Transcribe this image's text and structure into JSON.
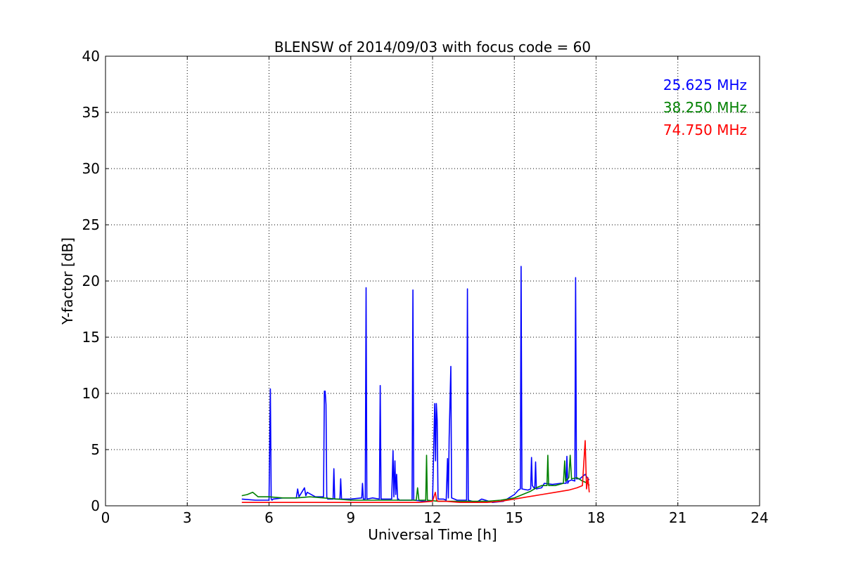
{
  "chart_data": {
    "type": "line",
    "title": "BLENSW of 2014/09/03 with focus code = 60",
    "xlabel": "Universal Time [h]",
    "ylabel": "Y-factor [dB]",
    "xlim": [
      0,
      24
    ],
    "ylim": [
      0,
      40
    ],
    "xticks": [
      0,
      3,
      6,
      9,
      12,
      15,
      18,
      21,
      24
    ],
    "xtick_labels": [
      "0",
      "3",
      "6",
      "9",
      "12",
      "15",
      "18",
      "21",
      "24"
    ],
    "yticks": [
      0,
      5,
      10,
      15,
      20,
      25,
      30,
      35,
      40
    ],
    "ytick_labels": [
      "0",
      "5",
      "10",
      "15",
      "20",
      "25",
      "30",
      "35",
      "40"
    ],
    "grid": true,
    "legend_position": "top-right",
    "series": [
      {
        "name": "25.625 MHz",
        "color": "#0000ff",
        "x": [
          5.0,
          5.5,
          6.0,
          6.05,
          6.08,
          6.11,
          6.15,
          6.5,
          7.0,
          7.05,
          7.1,
          7.3,
          7.35,
          7.4,
          7.7,
          8.0,
          8.03,
          8.06,
          8.09,
          8.12,
          8.15,
          8.35,
          8.38,
          8.41,
          8.6,
          8.63,
          8.66,
          9.0,
          9.4,
          9.43,
          9.46,
          9.53,
          9.56,
          9.59,
          9.8,
          10.05,
          10.08,
          10.11,
          10.5,
          10.55,
          10.58,
          10.62,
          10.65,
          10.68,
          10.72,
          10.75,
          10.78,
          10.9,
          11.25,
          11.28,
          11.31,
          11.7,
          12.0,
          12.08,
          12.11,
          12.14,
          12.17,
          12.2,
          12.25,
          12.4,
          12.5,
          12.55,
          12.58,
          12.61,
          12.64,
          12.67,
          12.7,
          12.9,
          13.25,
          13.28,
          13.31,
          13.6,
          13.8,
          14.2,
          14.6,
          15.0,
          15.15,
          15.22,
          15.25,
          15.28,
          15.5,
          15.6,
          15.63,
          15.66,
          15.75,
          15.78,
          15.81,
          16.0,
          16.1,
          16.4,
          16.7,
          16.9,
          16.93,
          16.96,
          17.0,
          17.1,
          17.22,
          17.25,
          17.28,
          17.4,
          17.5,
          17.6,
          17.7,
          17.75
        ],
        "y": [
          0.6,
          0.5,
          0.5,
          10.4,
          0.6,
          0.5,
          0.6,
          0.7,
          0.7,
          1.5,
          0.8,
          1.6,
          0.9,
          1.2,
          0.8,
          0.8,
          10.2,
          10.2,
          9.0,
          0.8,
          0.6,
          0.6,
          3.3,
          0.6,
          0.6,
          2.4,
          0.6,
          0.6,
          0.7,
          2.0,
          0.6,
          0.6,
          19.4,
          0.6,
          0.7,
          0.6,
          10.7,
          0.6,
          0.6,
          4.9,
          0.8,
          4.0,
          1.0,
          2.8,
          0.5,
          0.6,
          0.5,
          0.5,
          0.5,
          19.2,
          0.5,
          0.4,
          0.4,
          9.1,
          4.0,
          9.1,
          7.6,
          0.6,
          0.6,
          0.6,
          0.5,
          4.2,
          0.7,
          6.0,
          9.2,
          12.4,
          0.7,
          0.5,
          0.5,
          19.3,
          0.5,
          0.3,
          0.6,
          0.3,
          0.4,
          1.0,
          1.4,
          1.5,
          21.3,
          1.5,
          1.4,
          1.5,
          4.3,
          1.8,
          1.5,
          3.9,
          1.5,
          1.6,
          2.0,
          1.9,
          2.0,
          2.0,
          4.4,
          2.0,
          2.2,
          2.3,
          2.2,
          20.3,
          2.4,
          2.4,
          2.6,
          2.8,
          2.4,
          2.3
        ]
      },
      {
        "name": "38.250 MHz",
        "color": "#008000",
        "x": [
          5.0,
          5.2,
          5.4,
          5.6,
          6.0,
          6.5,
          7.0,
          7.5,
          8.0,
          8.5,
          9.0,
          9.5,
          10.0,
          10.5,
          11.0,
          11.4,
          11.45,
          11.5,
          11.75,
          11.78,
          11.81,
          12.2,
          12.5,
          13.0,
          13.5,
          14.0,
          14.5,
          15.0,
          15.3,
          15.6,
          15.8,
          16.0,
          16.2,
          16.23,
          16.26,
          16.5,
          16.8,
          16.85,
          16.88,
          17.0,
          17.05,
          17.1,
          17.3,
          17.5,
          17.7,
          17.75
        ],
        "y": [
          0.9,
          1.0,
          1.2,
          0.8,
          0.8,
          0.7,
          0.7,
          0.8,
          0.7,
          0.6,
          0.5,
          0.5,
          0.5,
          0.5,
          0.5,
          0.5,
          1.6,
          0.5,
          0.5,
          4.5,
          0.5,
          0.4,
          0.4,
          0.4,
          0.4,
          0.4,
          0.5,
          0.7,
          1.0,
          1.3,
          1.6,
          1.8,
          1.8,
          4.5,
          1.8,
          1.8,
          2.0,
          4.0,
          2.2,
          2.5,
          4.5,
          2.4,
          2.5,
          2.2,
          2.0,
          1.8
        ]
      },
      {
        "name": "74.750 MHz",
        "color": "#ff0000",
        "x": [
          5.0,
          5.5,
          6.0,
          6.5,
          7.0,
          7.5,
          8.0,
          8.5,
          9.0,
          9.5,
          10.0,
          10.5,
          11.0,
          11.5,
          12.0,
          12.1,
          12.15,
          12.2,
          12.5,
          13.0,
          13.5,
          14.0,
          14.5,
          15.0,
          15.5,
          16.0,
          16.5,
          17.0,
          17.3,
          17.5,
          17.6,
          17.65,
          17.7,
          17.75
        ],
        "y": [
          0.3,
          0.3,
          0.3,
          0.3,
          0.3,
          0.3,
          0.3,
          0.3,
          0.3,
          0.3,
          0.3,
          0.3,
          0.3,
          0.3,
          0.4,
          1.2,
          0.5,
          0.4,
          0.4,
          0.3,
          0.3,
          0.3,
          0.4,
          0.6,
          0.8,
          1.0,
          1.2,
          1.4,
          1.6,
          1.8,
          5.8,
          1.5,
          2.5,
          1.2
        ]
      }
    ]
  }
}
